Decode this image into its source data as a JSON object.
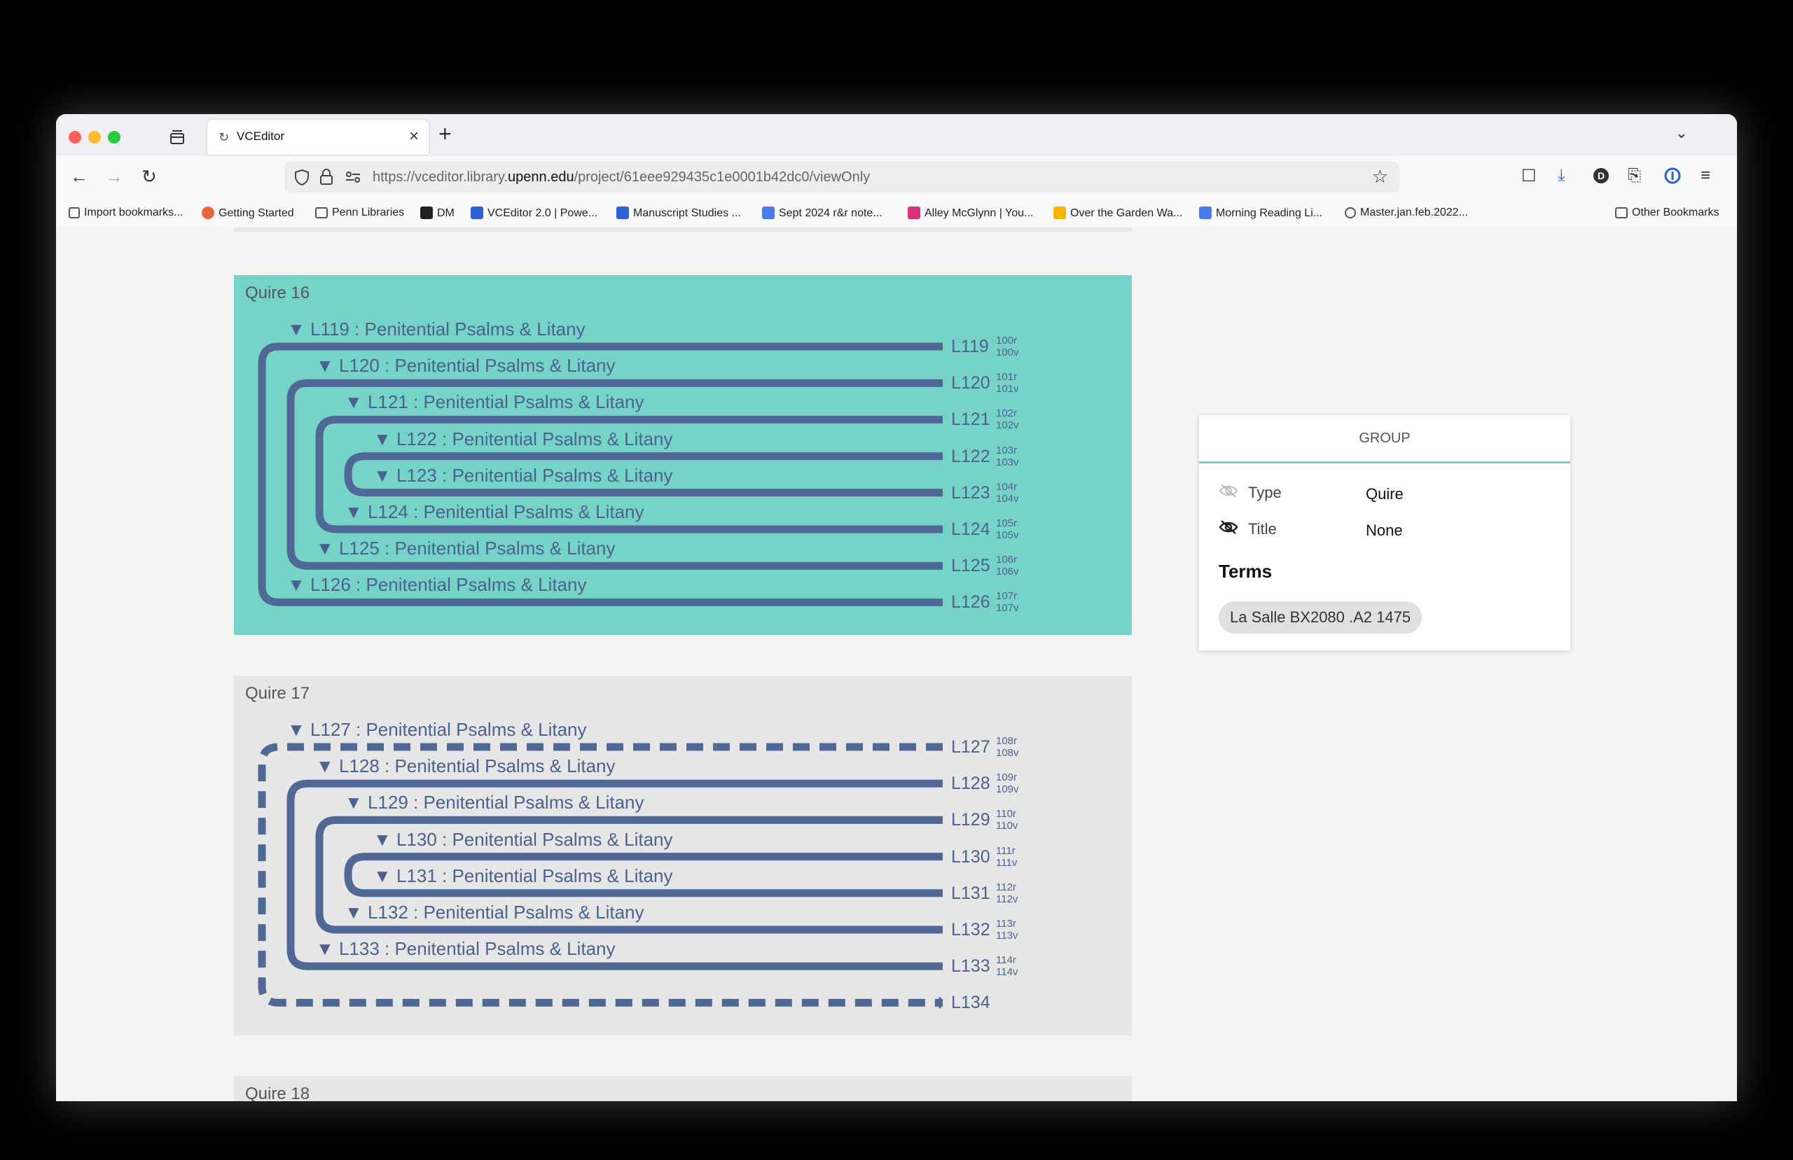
{
  "browser": {
    "tab_title": "VCEditor",
    "url_prefix": "https://vceditor.library.",
    "url_domain": "upenn.edu",
    "url_path": "/project/61eee929435c1e0001b42dc0/viewOnly"
  },
  "bookmarks": [
    {
      "label": "Import bookmarks...",
      "icon": "import-icon"
    },
    {
      "label": "Getting Started",
      "icon": "firefox-icon"
    },
    {
      "label": "Penn Libraries",
      "icon": "folder-icon"
    },
    {
      "label": "DM",
      "icon": "m-logo-icon"
    },
    {
      "label": "VCEditor 2.0 | Powe...",
      "icon": "box-icon"
    },
    {
      "label": "Manuscript Studies ...",
      "icon": "box-icon"
    },
    {
      "label": "Sept 2024 r&r note...",
      "icon": "docs-icon"
    },
    {
      "label": "Alley McGlynn | You...",
      "icon": "instagram-icon"
    },
    {
      "label": "Over the Garden Wa...",
      "icon": "drive-icon"
    },
    {
      "label": "Morning Reading Li...",
      "icon": "docs-icon"
    },
    {
      "label": "Master.jan.feb.2022...",
      "icon": "globe-icon"
    },
    {
      "label": "Other Bookmarks",
      "icon": "folder-icon"
    }
  ],
  "quires": [
    {
      "label": "Quire 16",
      "selected": true,
      "leaves": [
        {
          "id": "L119",
          "title": "▼ L119 : Penitential Psalms & Litany",
          "recto": "100r",
          "verso": "100v"
        },
        {
          "id": "L120",
          "title": "▼ L120 : Penitential Psalms & Litany",
          "recto": "101r",
          "verso": "101v"
        },
        {
          "id": "L121",
          "title": "▼ L121 : Penitential Psalms & Litany",
          "recto": "102r",
          "verso": "102v"
        },
        {
          "id": "L122",
          "title": "▼ L122 : Penitential Psalms & Litany",
          "recto": "103r",
          "verso": "103v"
        },
        {
          "id": "L123",
          "title": "▼ L123 : Penitential Psalms & Litany",
          "recto": "104r",
          "verso": "104v"
        },
        {
          "id": "L124",
          "title": "▼ L124 : Penitential Psalms & Litany",
          "recto": "105r",
          "verso": "105v"
        },
        {
          "id": "L125",
          "title": "▼ L125 : Penitential Psalms & Litany",
          "recto": "106r",
          "verso": "106v"
        },
        {
          "id": "L126",
          "title": "▼ L126 : Penitential Psalms & Litany",
          "recto": "107r",
          "verso": "107v"
        }
      ]
    },
    {
      "label": "Quire 17",
      "selected": false,
      "leaves": [
        {
          "id": "L127",
          "title": "▼ L127 : Penitential Psalms & Litany",
          "recto": "108r",
          "verso": "108v"
        },
        {
          "id": "L128",
          "title": "▼ L128 : Penitential Psalms & Litany",
          "recto": "109r",
          "verso": "109v"
        },
        {
          "id": "L129",
          "title": "▼ L129 : Penitential Psalms & Litany",
          "recto": "110r",
          "verso": "110v"
        },
        {
          "id": "L130",
          "title": "▼ L130 : Penitential Psalms & Litany",
          "recto": "111r",
          "verso": "111v"
        },
        {
          "id": "L131",
          "title": "▼ L131 : Penitential Psalms & Litany",
          "recto": "112r",
          "verso": "112v"
        },
        {
          "id": "L132",
          "title": "▼ L132 : Penitential Psalms & Litany",
          "recto": "113r",
          "verso": "113v"
        },
        {
          "id": "L133",
          "title": "▼ L133 : Penitential Psalms & Litany",
          "recto": "114r",
          "verso": "114v"
        },
        {
          "id": "L134",
          "title": "",
          "recto": "",
          "verso": "",
          "missing": true
        }
      ]
    },
    {
      "label": "Quire 18",
      "selected": false,
      "leaves": []
    }
  ],
  "group_panel": {
    "header": "GROUP",
    "type_label": "Type",
    "type_value": "Quire",
    "title_label": "Title",
    "title_value": "None",
    "terms_heading": "Terms",
    "term_chip": "La Salle BX2080 .A2 1475"
  },
  "colors": {
    "leaf": "#4f6896",
    "selected_bg": "#76d3c8",
    "quire_bg": "#e6e6e6",
    "accent": "#73d3c9"
  }
}
